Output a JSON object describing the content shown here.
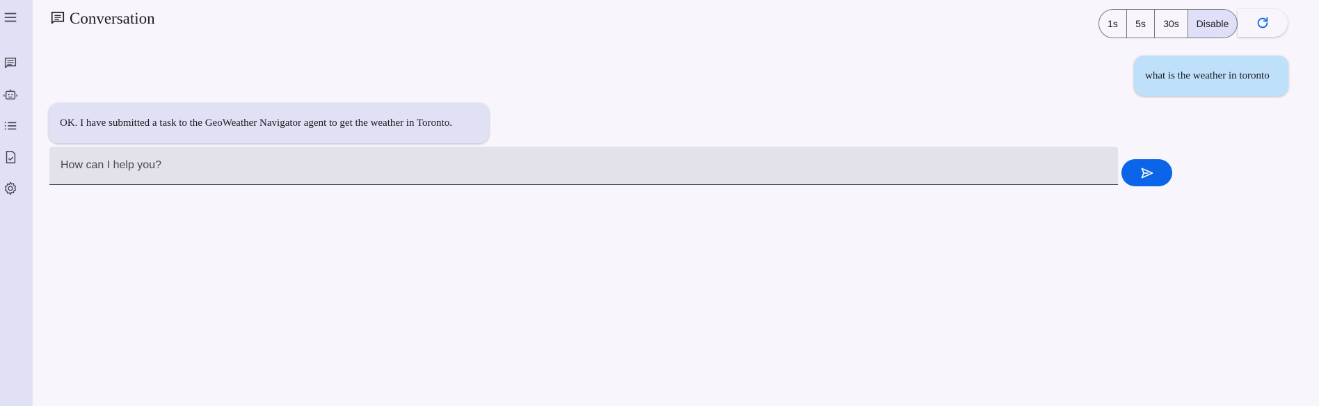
{
  "app": {
    "title": "Conversation"
  },
  "sidebar": {
    "items": [
      {
        "icon": "menu-icon"
      },
      {
        "icon": "chat-icon"
      },
      {
        "icon": "robot-icon"
      },
      {
        "icon": "list-icon"
      },
      {
        "icon": "task-icon"
      },
      {
        "icon": "settings-icon"
      }
    ]
  },
  "header": {
    "title_icon": "chat-icon",
    "poll_options": [
      {
        "label": "1s",
        "active": false
      },
      {
        "label": "5s",
        "active": false
      },
      {
        "label": "30s",
        "active": false
      },
      {
        "label": "Disable",
        "active": true
      }
    ],
    "refresh_icon": "refresh-icon"
  },
  "messages": [
    {
      "role": "user",
      "text": "what is the weather in toronto"
    },
    {
      "role": "agent",
      "text": "OK. I have submitted a task to the GeoWeather Navigator agent to get the weather in Toronto."
    }
  ],
  "composer": {
    "placeholder": "How can I help you?",
    "value": "",
    "send_icon": "send-icon"
  },
  "colors": {
    "accent": "#0b65e8",
    "sidebar_bg": "#e1e1f5",
    "user_bubble": "#bfe0fb",
    "agent_bubble": "#e1e1f5",
    "page_bg": "#f8f6fc"
  }
}
